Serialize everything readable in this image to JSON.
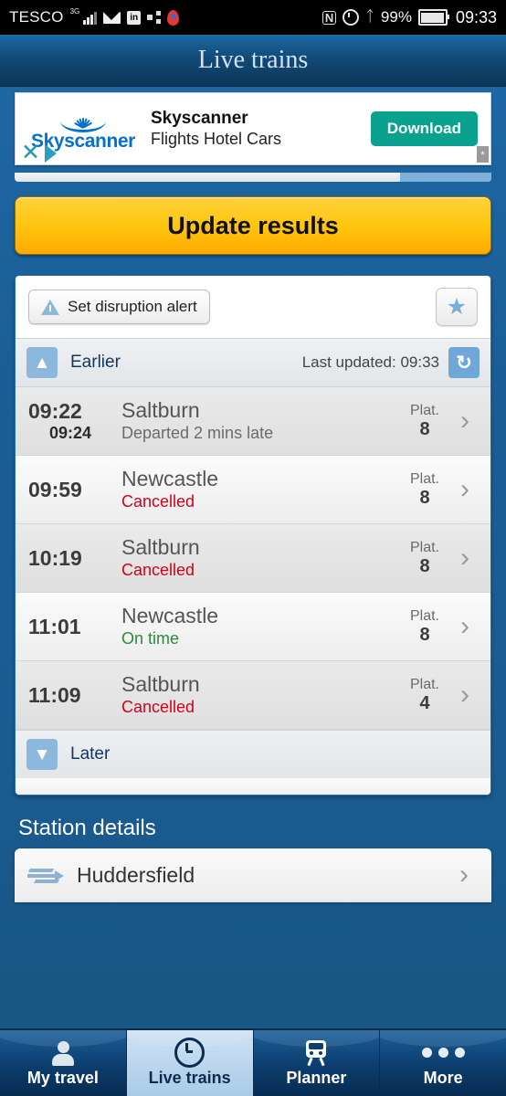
{
  "status_bar": {
    "carrier": "TESCO",
    "network": "3G",
    "battery_percent": "99%",
    "time": "09:33",
    "icons": [
      "signal-bars-icon",
      "mail-icon",
      "linkedin-icon",
      "sync-icon",
      "maps-pin-icon",
      "nfc-icon",
      "alarm-icon",
      "bluetooth-icon",
      "battery-icon"
    ]
  },
  "header": {
    "title": "Live trains"
  },
  "ad": {
    "brand": "Skyscanner",
    "headline": "Skyscanner",
    "subtext": "Flights Hotel Cars",
    "cta": "Download",
    "close_icon": "close-icon",
    "adchoices_icon": "adchoices-icon",
    "info_marker": "*"
  },
  "update_button": {
    "label": "Update results"
  },
  "results": {
    "disruption_button": "Set disruption alert",
    "favourite_icon": "star-icon",
    "earlier_label": "Earlier",
    "last_updated": "Last updated: 09:33",
    "refresh_icon": "refresh-icon",
    "later_label": "Later",
    "platform_label": "Plat.",
    "rows": [
      {
        "time": "09:22",
        "revised_time": "09:24",
        "destination": "Saltburn",
        "status": "Departed 2 mins late",
        "status_kind": "late",
        "platform": "8"
      },
      {
        "time": "09:59",
        "revised_time": "",
        "destination": "Newcastle",
        "status": "Cancelled",
        "status_kind": "cancelled",
        "platform": "8"
      },
      {
        "time": "10:19",
        "revised_time": "",
        "destination": "Saltburn",
        "status": "Cancelled",
        "status_kind": "cancelled",
        "platform": "8"
      },
      {
        "time": "11:01",
        "revised_time": "",
        "destination": "Newcastle",
        "status": "On time",
        "status_kind": "ontime",
        "platform": "8"
      },
      {
        "time": "11:09",
        "revised_time": "",
        "destination": "Saltburn",
        "status": "Cancelled",
        "status_kind": "cancelled",
        "platform": "4"
      }
    ]
  },
  "station_details": {
    "heading": "Station details",
    "station": "Huddersfield",
    "logo_icon": "national-rail-icon"
  },
  "tabbar": {
    "tabs": [
      {
        "label": "My travel",
        "icon": "person-icon",
        "active": false
      },
      {
        "label": "Live trains",
        "icon": "clock-icon",
        "active": true
      },
      {
        "label": "Planner",
        "icon": "train-icon",
        "active": false
      },
      {
        "label": "More",
        "icon": "more-dots-icon",
        "active": false
      }
    ]
  },
  "colors": {
    "accent_blue": "#1b5d96",
    "button_amber": "#ffc60f",
    "cancelled_red": "#d0021b",
    "ontime_green": "#2c8a3e",
    "ad_cta_teal": "#0aa18f"
  }
}
